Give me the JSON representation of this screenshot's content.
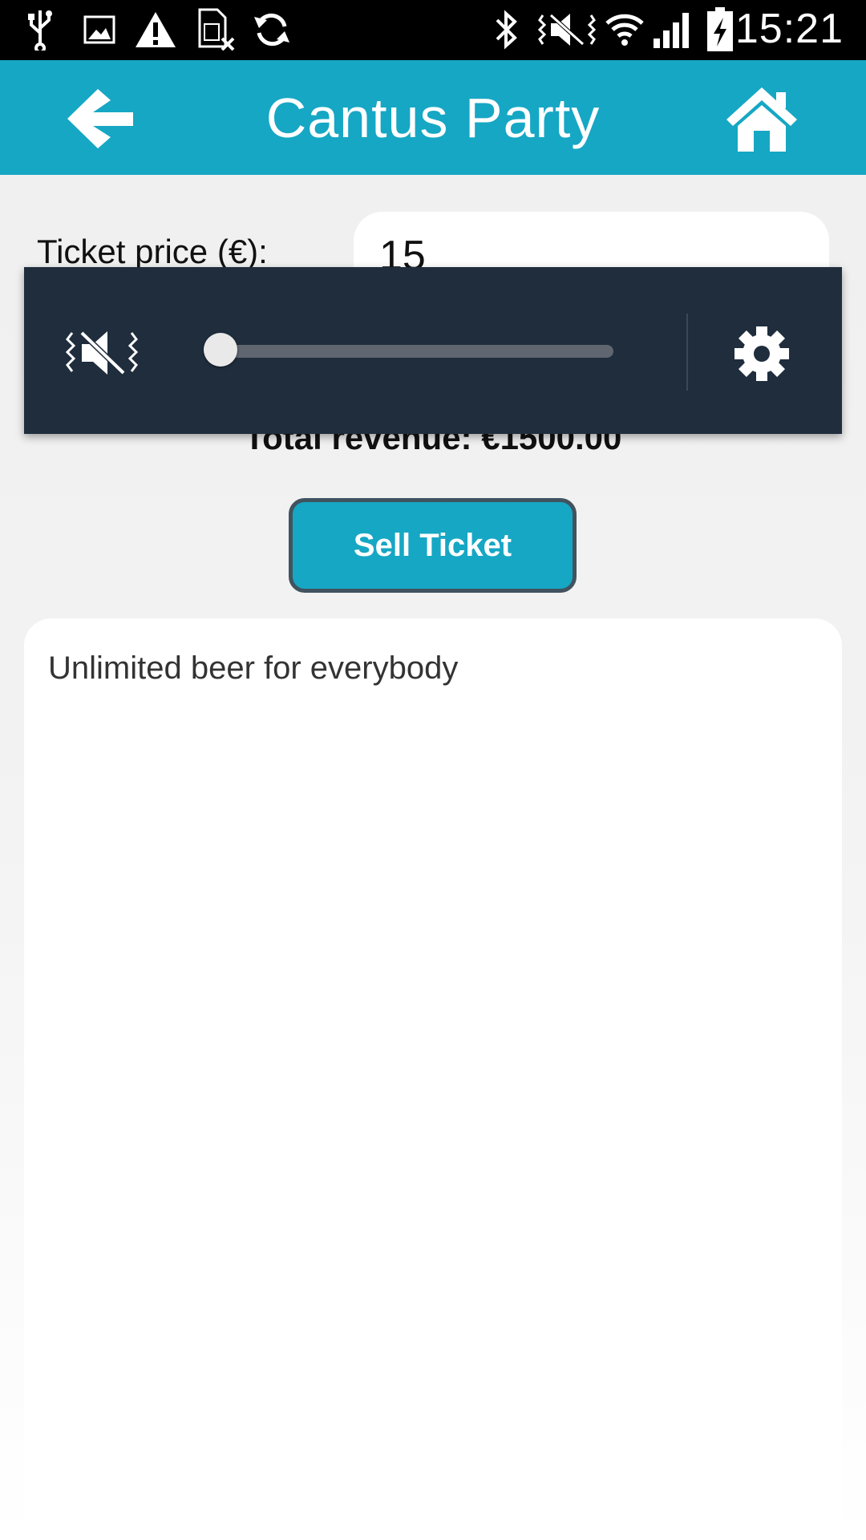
{
  "status_bar": {
    "time": "15:21",
    "icons_left": [
      "usb-icon",
      "image-icon",
      "warning-icon",
      "sim-card-x-icon",
      "sync-icon"
    ],
    "icons_right": [
      "bluetooth-icon",
      "vibrate-icon",
      "wifi-icon",
      "signal-icon",
      "battery-charging-icon"
    ]
  },
  "appbar": {
    "title": "Cantus Party",
    "back_icon": "arrow-left-icon",
    "home_icon": "home-icon",
    "color": "#16a7c4"
  },
  "form": {
    "price_label": "Ticket price (€):",
    "price_value": "15",
    "total_revenue": "Total revenue: €1500.00"
  },
  "volume_overlay": {
    "mute_icon": "vibrate-mute-icon",
    "level": 0,
    "settings_icon": "gear-icon",
    "background": "#1f2d3d"
  },
  "actions": {
    "sell_label": "Sell Ticket"
  },
  "description": {
    "text": "Unlimited beer for everybody"
  }
}
